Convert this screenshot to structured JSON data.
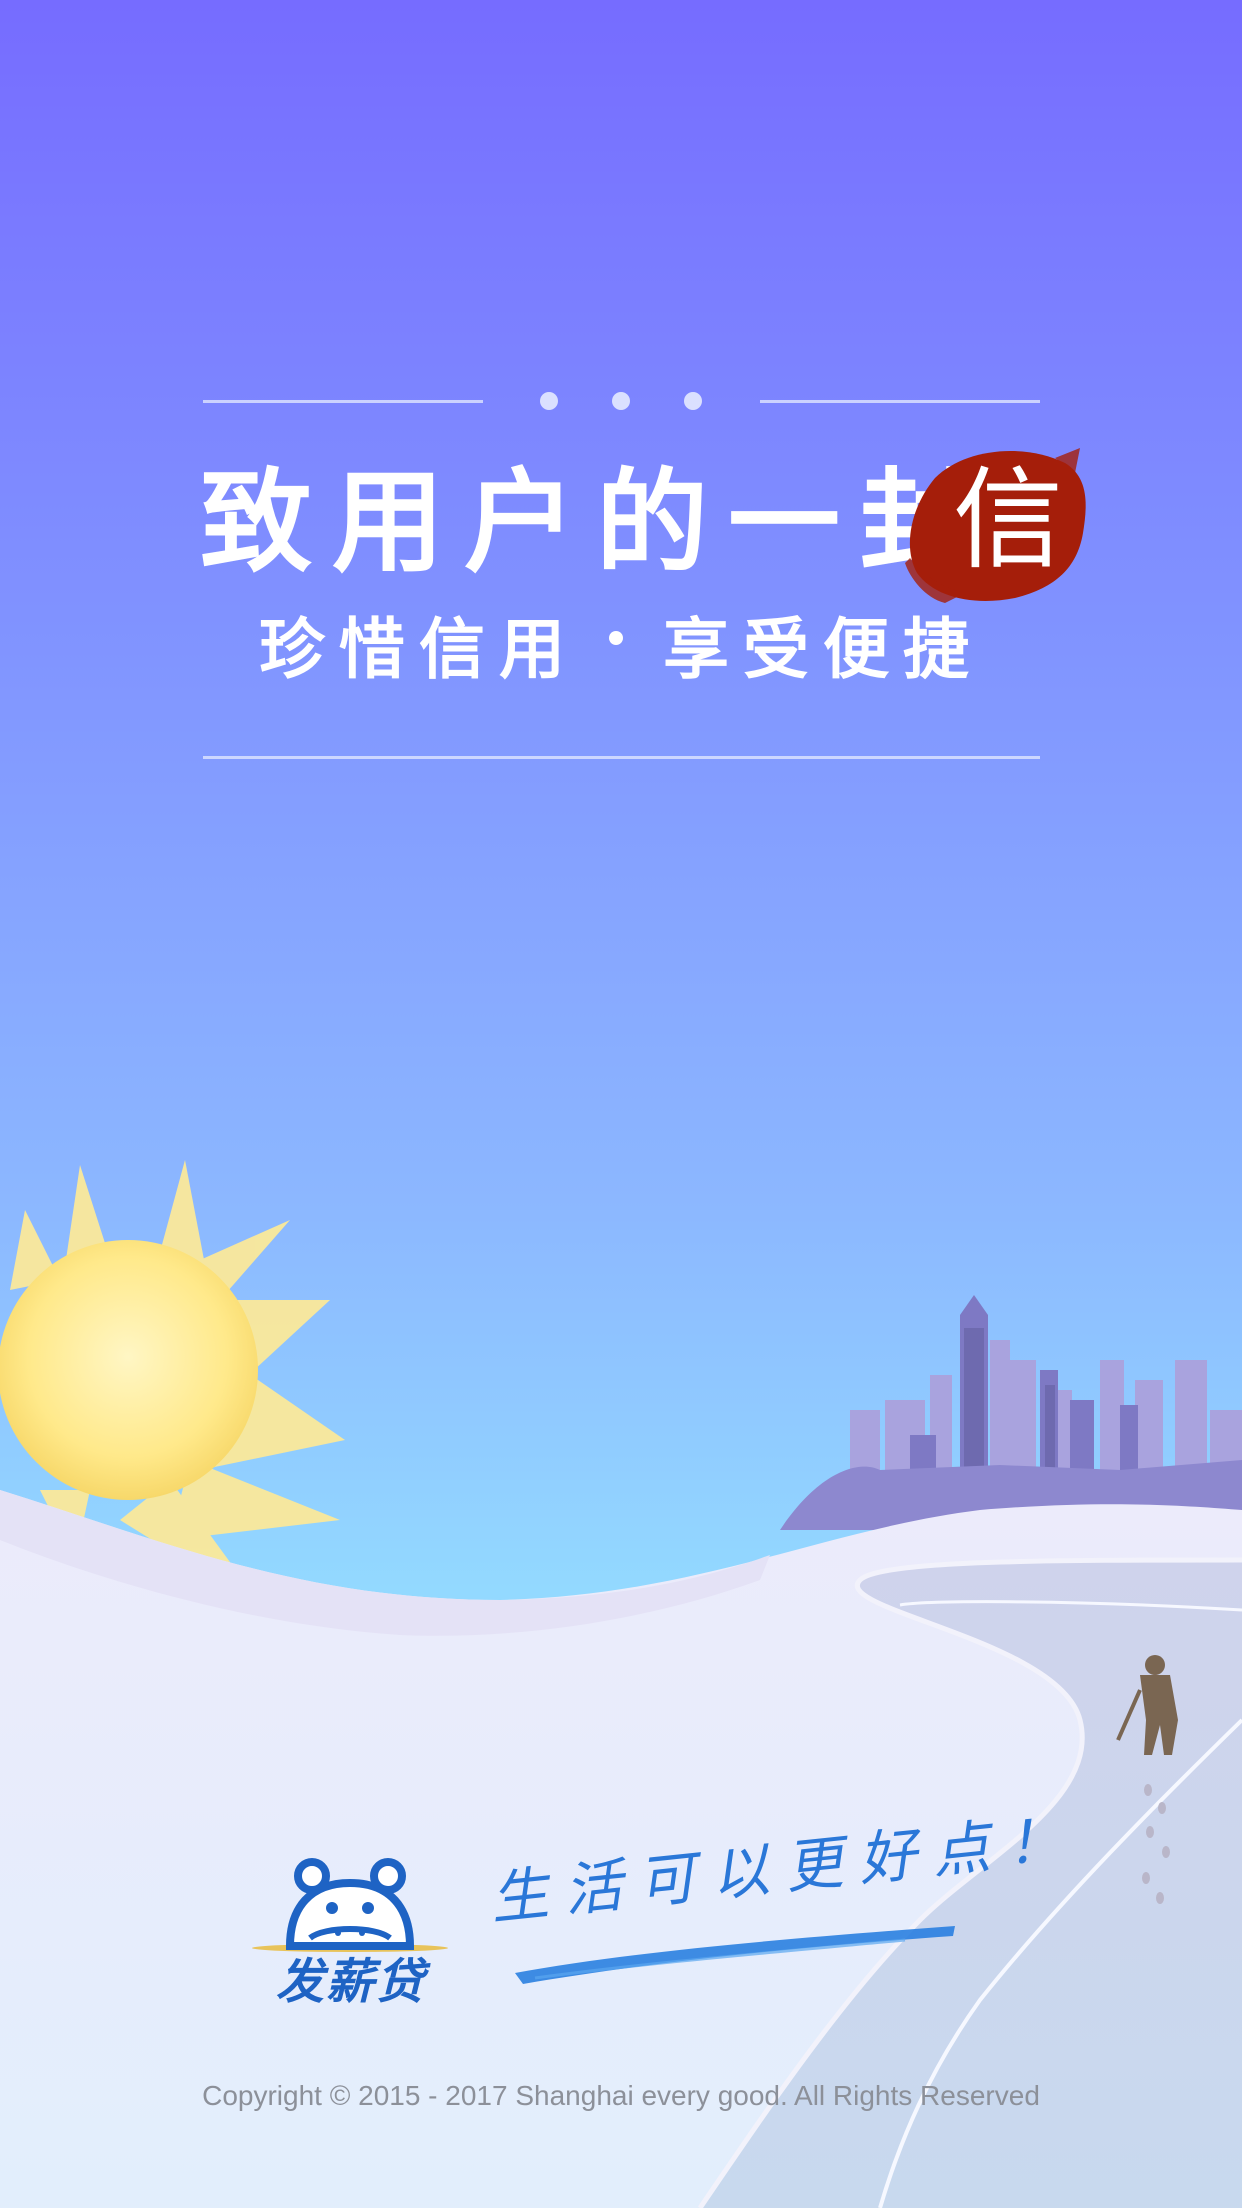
{
  "letter": {
    "title": "致用户的一封",
    "title_stamp_char": "信",
    "subtitle_left": "珍惜信用",
    "subtitle_right": "享受便捷"
  },
  "brand": {
    "logo_icon": "hippo-mascot-icon",
    "logo_text": "发薪贷",
    "slogan": "生活可以更好点！"
  },
  "footer": {
    "copyright": "Copyright © 2015 - 2017 Shanghai every good. All Rights Reserved"
  },
  "colors": {
    "sky_top": "#766cff",
    "sky_bottom": "#a6e2ff",
    "stamp_red": "#a51e0a",
    "brand_blue": "#1e63c4",
    "sun": "#ffe98a"
  }
}
